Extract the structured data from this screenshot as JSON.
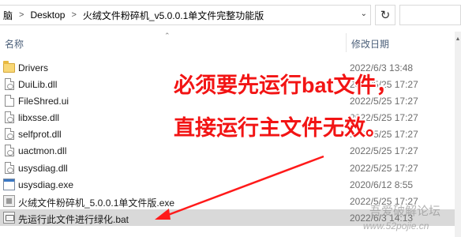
{
  "address_bar": {
    "crumbs": [
      "脑",
      "Desktop",
      "火绒文件粉碎机_v5.0.0.1单文件完整功能版"
    ],
    "separator": ">"
  },
  "refresh_icon": "refresh-icon",
  "columns": {
    "name": "名称",
    "modified": "修改日期"
  },
  "files": [
    {
      "name": "Drivers",
      "date": "2022/6/3 13:48",
      "icon": "folder-icon",
      "selected": false
    },
    {
      "name": "DuiLib.dll",
      "date": "2022/5/25 17:27",
      "icon": "dll-file-icon",
      "selected": false
    },
    {
      "name": "FileShred.ui",
      "date": "2022/5/25 17:27",
      "icon": "file-icon",
      "selected": false
    },
    {
      "name": "libxsse.dll",
      "date": "2022/5/25 17:27",
      "icon": "dll-file-icon",
      "selected": false
    },
    {
      "name": "selfprot.dll",
      "date": "2022/5/25 17:27",
      "icon": "dll-file-icon",
      "selected": false
    },
    {
      "name": "uactmon.dll",
      "date": "2022/5/25 17:27",
      "icon": "dll-file-icon",
      "selected": false
    },
    {
      "name": "usysdiag.dll",
      "date": "2022/5/25 17:27",
      "icon": "dll-file-icon",
      "selected": false
    },
    {
      "name": "usysdiag.exe",
      "date": "2020/6/12 8:55",
      "icon": "exe-icon",
      "selected": false
    },
    {
      "name": "火绒文件粉碎机_5.0.0.1单文件版.exe",
      "date": "2022/5/25 17:27",
      "icon": "app-exe-icon",
      "selected": false
    },
    {
      "name": "先运行此文件进行绿化.bat",
      "date": "2022/6/3 14:13",
      "icon": "bat-file-icon",
      "selected": true
    }
  ],
  "annotation": {
    "line1": "必须要先运行bat文件，",
    "line2": "直接运行主文件无效。",
    "color": "#f21414"
  },
  "watermark": {
    "line1": "吾爱破解论坛",
    "line2": "www.52pojie.cn"
  }
}
